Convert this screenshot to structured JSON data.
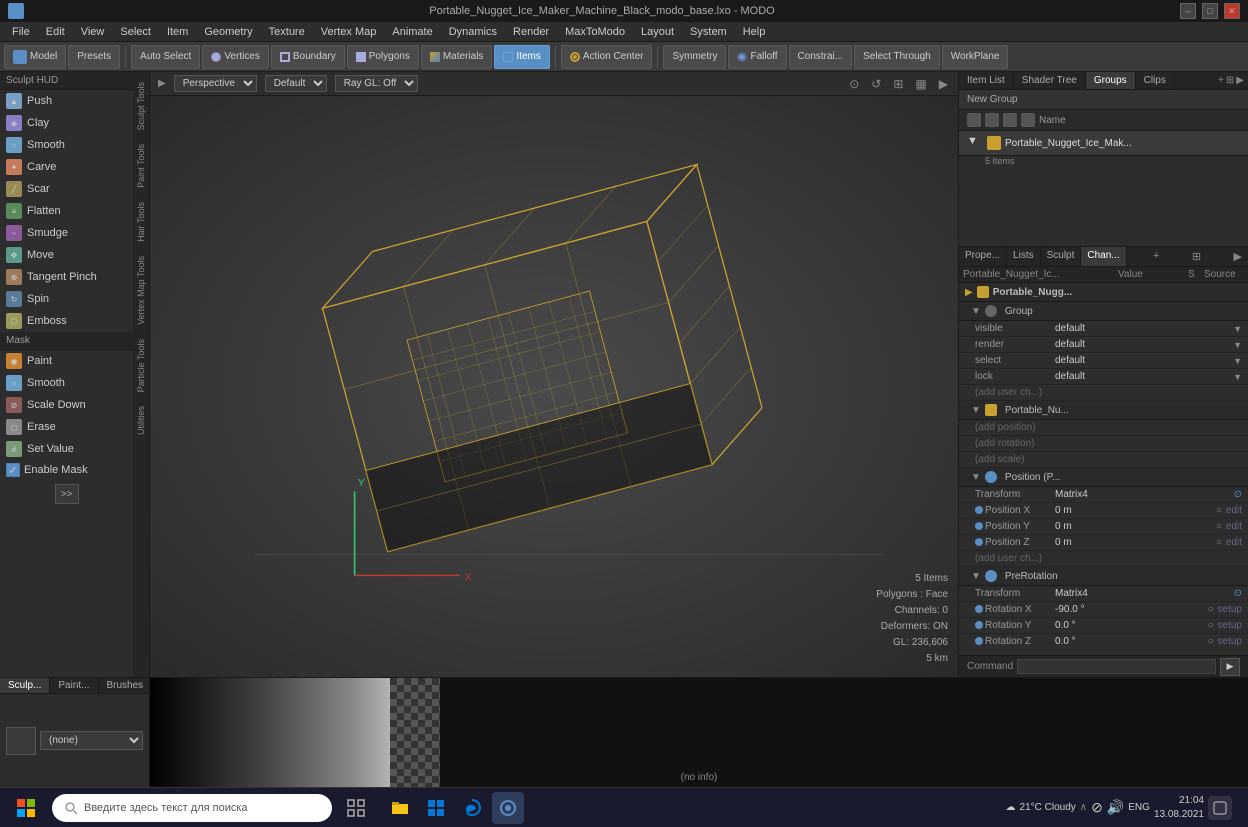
{
  "titlebar": {
    "title": "Portable_Nugget_Ice_Maker_Machine_Black_modo_base.lxo - MODO",
    "controls": [
      "–",
      "□",
      "✕"
    ]
  },
  "menubar": {
    "items": [
      "File",
      "Edit",
      "View",
      "Select",
      "Item",
      "Geometry",
      "Texture",
      "Vertex Map",
      "Animate",
      "Dynamics",
      "Render",
      "MaxToModo",
      "Layout",
      "System",
      "Help"
    ]
  },
  "toolbar": {
    "model_label": "Model",
    "presets_label": "Presets",
    "auto_select": "Auto Select",
    "vertices": "Vertices",
    "boundary": "Boundary",
    "polygons": "Polygons",
    "materials": "Materials",
    "items": "Items",
    "action_center": "Action Center",
    "symmetry": "Symmetry",
    "falloff": "Falloff",
    "constrain": "Constrai...",
    "select_through": "Select Through",
    "workplane": "WorkPlane"
  },
  "viewport": {
    "perspective": "Perspective",
    "default": "Default",
    "ray_gl": "Ray GL: Off",
    "info": {
      "items": "5 Items",
      "polygons": "Polygons : Face",
      "channels": "Channels: 0",
      "deformers": "Deformers: ON",
      "gl": "GL: 236,606",
      "distance": "5 km"
    }
  },
  "sculpt_tools": {
    "header": "Sculpt HUD",
    "tools": [
      {
        "label": "Push",
        "icon": "push"
      },
      {
        "label": "Clay",
        "icon": "clay"
      },
      {
        "label": "Smooth",
        "icon": "smooth"
      },
      {
        "label": "Carve",
        "icon": "carve"
      },
      {
        "label": "Scar",
        "icon": "scar"
      },
      {
        "label": "Flatten",
        "icon": "flatten"
      },
      {
        "label": "Smudge",
        "icon": "smudge"
      },
      {
        "label": "Move",
        "icon": "move"
      },
      {
        "label": "Tangent Pinch",
        "icon": "tangent-pinch"
      },
      {
        "label": "Spin",
        "icon": "spin"
      },
      {
        "label": "Emboss",
        "icon": "emboss"
      }
    ],
    "mask_section": "Mask",
    "mask_tools": [
      {
        "label": "Paint",
        "icon": "paint"
      },
      {
        "label": "Smooth",
        "icon": "smooth"
      },
      {
        "label": "Scale Down",
        "icon": "scale-down"
      }
    ],
    "utility_tools": [
      {
        "label": "Erase",
        "icon": "erase"
      },
      {
        "label": "Set Value",
        "icon": "set-value"
      }
    ],
    "enable_mask": "Enable Mask"
  },
  "vertical_tabs": [
    "Sculpt Tools",
    "Paint Tools",
    "Hair Tools",
    "Vertex Map Tools",
    "Particle Tools",
    "Utilities"
  ],
  "right_panel": {
    "tabs": [
      "Item List",
      "Shader Tree",
      "Groups",
      "Clips"
    ],
    "active_tab": "Groups",
    "new_group": "New Group",
    "list_header": "Name",
    "group_name": "Portable_Nugget_Ice_Mak...",
    "group_sublabel": "5 Items"
  },
  "props_tabs": [
    "Prope...",
    "Lists",
    "Sculpt",
    "Chan..."
  ],
  "props_active": "Chan...",
  "props_table": {
    "header_cols": [
      "Portable_Nugget_Ic...",
      "Value",
      "S",
      "Source"
    ],
    "rows": [
      {
        "indent": 0,
        "label": "Portable_Nugg...",
        "value": "",
        "s": "",
        "src": "",
        "type": "section"
      },
      {
        "indent": 1,
        "label": "Group",
        "value": "",
        "s": "",
        "src": "",
        "type": "subsection"
      },
      {
        "indent": 2,
        "label": "visible",
        "value": "default",
        "s": "",
        "src": "▼",
        "type": "row"
      },
      {
        "indent": 2,
        "label": "render",
        "value": "default",
        "s": "",
        "src": "▼",
        "type": "row"
      },
      {
        "indent": 2,
        "label": "select",
        "value": "default",
        "s": "",
        "src": "▼",
        "type": "row"
      },
      {
        "indent": 2,
        "label": "lock",
        "value": "default",
        "s": "",
        "src": "▼",
        "type": "row"
      },
      {
        "indent": 2,
        "label": "(add user ch...)",
        "value": "",
        "s": "",
        "src": "",
        "type": "add"
      },
      {
        "indent": 1,
        "label": "Portable_Nu...",
        "value": "",
        "s": "",
        "src": "",
        "type": "subsection"
      },
      {
        "indent": 2,
        "label": "(add position)",
        "value": "",
        "s": "",
        "src": "",
        "type": "add"
      },
      {
        "indent": 2,
        "label": "(add rotation)",
        "value": "",
        "s": "",
        "src": "",
        "type": "add"
      },
      {
        "indent": 2,
        "label": "(add scale)",
        "value": "",
        "s": "",
        "src": "",
        "type": "add"
      },
      {
        "indent": 1,
        "label": "Position (P...",
        "value": "",
        "s": "",
        "src": "",
        "type": "subsection"
      },
      {
        "indent": 2,
        "label": "Transform",
        "value": "Matrix4",
        "s": "",
        "src": "⊙",
        "type": "transform"
      },
      {
        "indent": 2,
        "label": "Position X",
        "value": "0 m",
        "s": "○",
        "src": "edit",
        "type": "row"
      },
      {
        "indent": 2,
        "label": "Position Y",
        "value": "0 m",
        "s": "○",
        "src": "edit",
        "type": "row"
      },
      {
        "indent": 2,
        "label": "Position Z",
        "value": "0 m",
        "s": "○",
        "src": "edit",
        "type": "row"
      },
      {
        "indent": 2,
        "label": "(add user ch...)",
        "value": "",
        "s": "",
        "src": "",
        "type": "add"
      },
      {
        "indent": 1,
        "label": "PreRotation",
        "value": "",
        "s": "",
        "src": "",
        "type": "subsection"
      },
      {
        "indent": 2,
        "label": "Transform",
        "value": "Matrix4",
        "s": "",
        "src": "⊙",
        "type": "transform"
      },
      {
        "indent": 2,
        "label": "Rotation X",
        "value": "-90.0 °",
        "s": "○",
        "src": "setup",
        "type": "row"
      },
      {
        "indent": 2,
        "label": "Rotation Y",
        "value": "0.0 °",
        "s": "○",
        "src": "setup",
        "type": "row"
      },
      {
        "indent": 2,
        "label": "Rotation Z",
        "value": "0.0 °",
        "s": "○",
        "src": "setup",
        "type": "row"
      }
    ]
  },
  "command_bar": {
    "label": "Command",
    "placeholder": ""
  },
  "bottom": {
    "tabs": [
      "Sculp...",
      "Paint...",
      "Brushes"
    ],
    "preset_none": "(none)",
    "no_info": "(no info)"
  },
  "taskbar": {
    "search_placeholder": "Введите здесь текст для поиска",
    "weather": "21°C  Cloudy",
    "language": "ENG",
    "time": "21:04",
    "date": "13.08.2021"
  }
}
